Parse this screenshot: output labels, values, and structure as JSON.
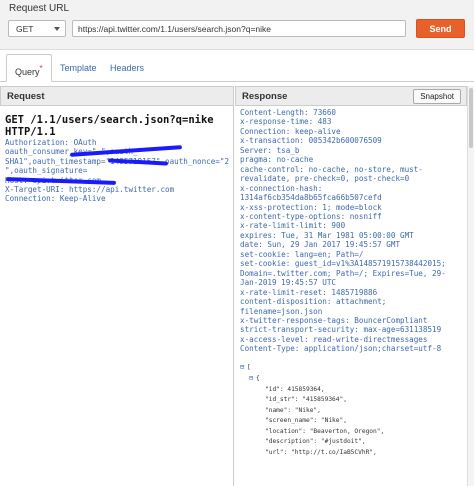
{
  "top": {
    "label": "Request URL",
    "method": "GET",
    "url": "https://api.twitter.com/1.1/users/search.json?q=nike",
    "send_label": "Send"
  },
  "tabs": [
    {
      "label": "Query",
      "marker": "*"
    },
    {
      "label": "Template"
    },
    {
      "label": "Headers"
    }
  ],
  "request": {
    "title": "Request",
    "line1": "GET /1.1/users/search.json?q=nike",
    "line2": "HTTP/1.1",
    "headers": [
      "Authorization: OAuth",
      "oauth_consumer_key=\"                    \",oauth_",
      "SHA1\",oauth_timestamp=\"1485719157\",oauth_nonce=\"2",
      "                    \",oauth_signature=",
      "Host: api.twitter.com",
      "X-Target-URI: https://api.twitter.com",
      "Connection: Keep-Alive"
    ]
  },
  "response": {
    "title": "Response",
    "snapshot_label": "Snapshot",
    "headers": [
      "Content-Length: 73660",
      "x-response-time: 483",
      "Connection: keep-alive",
      "x-transaction: 005342b600076509",
      "Server: tsa_b",
      "pragma: no-cache",
      "cache-control: no-cache, no-store, must-",
      "revalidate, pre-check=0, post-check=0",
      "x-connection-hash:",
      "1314af6cb354da8b65fca66b507cefd",
      "x-xss-protection: 1; mode=block",
      "x-content-type-options: nosniff",
      "x-rate-limit-limit: 900",
      "expires: Tue, 31 Mar 1981 05:00:00 GMT",
      "date: Sun, 29 Jan 2017 19:45:57 GMT",
      "set-cookie: lang=en; Path=/",
      "set-cookie: guest_id=v1%3A148571915738442015;",
      "Domain=.twitter.com; Path=/; Expires=Tue, 29-",
      "Jan-2019 19:45:57 UTC",
      "x-rate-limit-reset: 1485719886",
      "content-disposition: attachment;",
      "filename=json.json",
      "x-twitter-response-tags: BouncerCompliant",
      "strict-transport-security: max-age=631138519",
      "x-access-level: read-write-directmessages",
      "Content-Type: application/json;charset=utf-8"
    ],
    "json_lines": [
      {
        "indent": 0,
        "toggle": "⊟",
        "text": "["
      },
      {
        "indent": 1,
        "toggle": "⊟",
        "text": "{"
      },
      {
        "indent": 2,
        "toggle": "",
        "text": "\"id\": 415859364,"
      },
      {
        "indent": 2,
        "toggle": "",
        "text": "\"id_str\": \"415859364\","
      },
      {
        "indent": 2,
        "toggle": "",
        "text": "\"name\": \"Nike\","
      },
      {
        "indent": 2,
        "toggle": "",
        "text": "\"screen_name\": \"Nike\","
      },
      {
        "indent": 2,
        "toggle": "",
        "text": "\"location\": \"Beaverton, Oregon\","
      },
      {
        "indent": 2,
        "toggle": "",
        "text": "\"description\": \"#justdoit\","
      },
      {
        "indent": 2,
        "toggle": "",
        "text": "\"url\": \"http://t.co/IaB5CVhR\","
      }
    ]
  }
}
